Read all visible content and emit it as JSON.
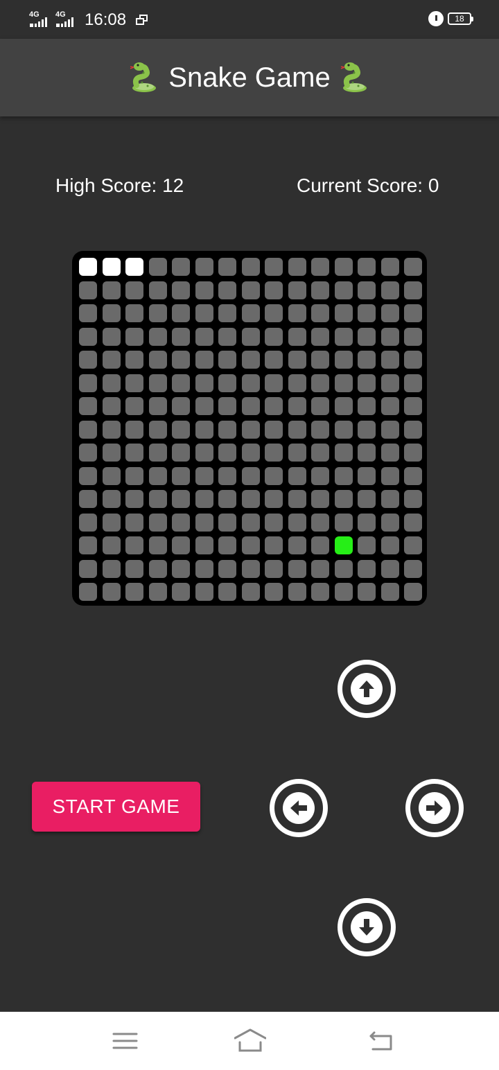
{
  "status_bar": {
    "network_1": "4G",
    "network_2": "4G",
    "time": "16:08",
    "battery_level": "18"
  },
  "app": {
    "title": "Snake Game",
    "title_icon": "snake-emoji"
  },
  "scores": {
    "high_score_text": "High Score: 12",
    "current_score_text": "Current Score: 0"
  },
  "board": {
    "columns": 15,
    "rows": 15,
    "snake": [
      [
        0,
        0
      ],
      [
        0,
        1
      ],
      [
        0,
        2
      ]
    ],
    "food": [
      12,
      11
    ],
    "colors": {
      "board_bg": "#000000",
      "cell": "#6a6a6a",
      "snake": "#ffffff",
      "food": "#26ee17"
    }
  },
  "controls": {
    "start_label": "START GAME",
    "up_icon": "arrow-up-icon",
    "left_icon": "arrow-left-icon",
    "right_icon": "arrow-right-icon",
    "down_icon": "arrow-down-icon",
    "accent": "#e91e63"
  },
  "nav_bar": {
    "items": [
      "menu-icon",
      "home-icon",
      "back-icon"
    ]
  }
}
